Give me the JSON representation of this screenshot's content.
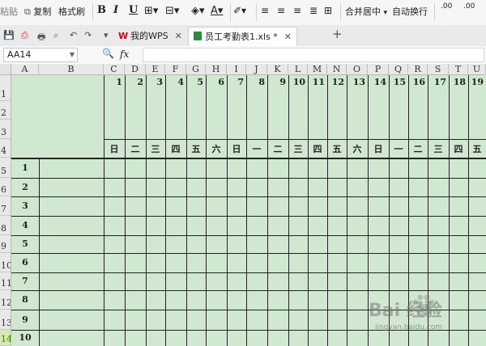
{
  "ribbon": {
    "paste_label": "粘贴",
    "copy_label": "复制",
    "format_painter_label": "格式刷",
    "bold_label": "B",
    "italic_label": "I",
    "underline_label": "U",
    "merge_center_label": "合并居中",
    "wrap_text_label": "自动换行",
    "decimal_label": ".00"
  },
  "tabs": [
    {
      "label": "我的WPS",
      "active": false
    },
    {
      "label": "员工考勤表1.xls *",
      "active": true
    }
  ],
  "add_tab_label": "+",
  "formula_bar": {
    "name_box": "AA14",
    "fx_label": "fx",
    "formula_value": ""
  },
  "columns": [
    "A",
    "B",
    "C",
    "D",
    "E",
    "F",
    "G",
    "H",
    "I",
    "J",
    "K",
    "L",
    "M",
    "N",
    "O",
    "P",
    "Q",
    "R",
    "S",
    "T",
    "U"
  ],
  "row_headers": [
    "1",
    "2",
    "3",
    "4",
    "5",
    "6",
    "7",
    "8",
    "9",
    "10",
    "11",
    "12",
    "13",
    "14"
  ],
  "selected_row": "14",
  "days": [
    "1",
    "2",
    "3",
    "4",
    "5",
    "6",
    "7",
    "8",
    "9",
    "10",
    "11",
    "12",
    "13",
    "14",
    "15",
    "16",
    "17",
    "18",
    "19"
  ],
  "weekdays": [
    "日",
    "二",
    "三",
    "四",
    "五",
    "六",
    "日",
    "一",
    "二",
    "三",
    "四",
    "五",
    "六",
    "日",
    "一",
    "二",
    "三",
    "四",
    "五"
  ],
  "employee_numbers": [
    "1",
    "2",
    "3",
    "4",
    "5",
    "6",
    "7",
    "8",
    "9",
    "10"
  ],
  "watermark": {
    "title": "Bai 经验",
    "sub": "jingyan.baidu.com"
  },
  "colors": {
    "sheet_bg": "#cfe8cf",
    "grid": "#222222",
    "selected_row_header": "#d7e8b8"
  }
}
